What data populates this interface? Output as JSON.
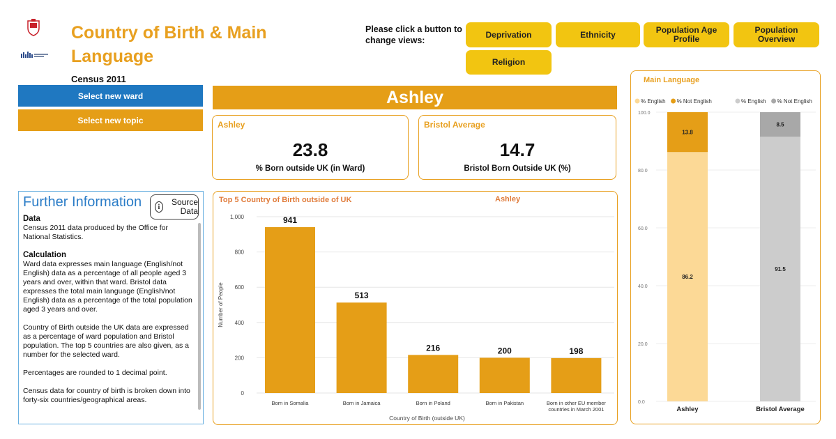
{
  "header": {
    "title": "Country of Birth & Main Language",
    "subtitle": "Census 2011",
    "prompt": "Please click a button to change views:",
    "nav_buttons": [
      "Deprivation",
      "Ethnicity",
      "Population Age Profile",
      "Population Overview",
      "Religion"
    ]
  },
  "sidebar": {
    "select_ward": "Select new ward",
    "select_topic": "Select new topic"
  },
  "ward_name": "Ashley",
  "cards": {
    "ward": {
      "label": "Ashley",
      "value": "23.8",
      "desc": "% Born outside UK (in Ward)"
    },
    "bristol": {
      "label": "Bristol Average",
      "value": "14.7",
      "desc": "Bristol Born Outside UK (%)"
    }
  },
  "info": {
    "title": "Further Information",
    "source_button": "Source Data",
    "data_heading": "Data",
    "data_text": "Census 2011 data produced by the Office for National Statistics.",
    "calc_heading": "Calculation",
    "calc_text": "Ward data expresses main language (English/not English) data as a percentage of all people aged 3 years and over, within that ward. Bristol data expresses the total main language (English/not English) data as a percentage of the total population aged 3 years and over.",
    "para2": "Country of Birth outside the UK data are expressed as a percentage of ward population and Bristol population. The top 5 countries are also given, as a number for the selected ward.",
    "para3": "Percentages are rounded to 1 decimal point.",
    "para4": "Census data for country of birth is broken down into forty-six countries/geographical areas."
  },
  "colors": {
    "accent": "#e59e17",
    "blue_button": "#1f78c1",
    "nav_yellow": "#f2c511",
    "english_light": "#fcd996",
    "grey_light": "#cccccc",
    "grey_dark": "#a8a8a8"
  },
  "chart_data": [
    {
      "type": "bar",
      "title": "Top 5 Country of Birth outside of UK",
      "subtitle": "Ashley",
      "categories": [
        "Born in Somalia",
        "Born in Jamaica",
        "Born in Poland",
        "Born in Pakistan",
        "Born in other EU member countries in March 2001"
      ],
      "values": [
        941,
        513,
        216,
        200,
        198
      ],
      "xlabel": "Country of Birth (outside UK)",
      "ylabel": "Number of People",
      "ylim": [
        0,
        1000
      ],
      "yticks": [
        "0",
        "200",
        "400",
        "600",
        "800",
        "1,000"
      ],
      "grid": true
    },
    {
      "type": "bar",
      "stacked": true,
      "title": "Main Language",
      "categories": [
        "Ashley",
        "Bristol Average"
      ],
      "legend": [
        {
          "labels": [
            "% English",
            "% Not English"
          ]
        },
        {
          "labels": [
            "% English",
            "% Not English"
          ]
        }
      ],
      "series": [
        {
          "name": "% English",
          "values": [
            86.2,
            91.5
          ]
        },
        {
          "name": "% Not English",
          "values": [
            13.8,
            8.5
          ]
        }
      ],
      "ylim": [
        0,
        100
      ],
      "yticks": [
        "0.0",
        "20.0",
        "40.0",
        "60.0",
        "80.0",
        "100.0"
      ],
      "grid": true
    }
  ]
}
